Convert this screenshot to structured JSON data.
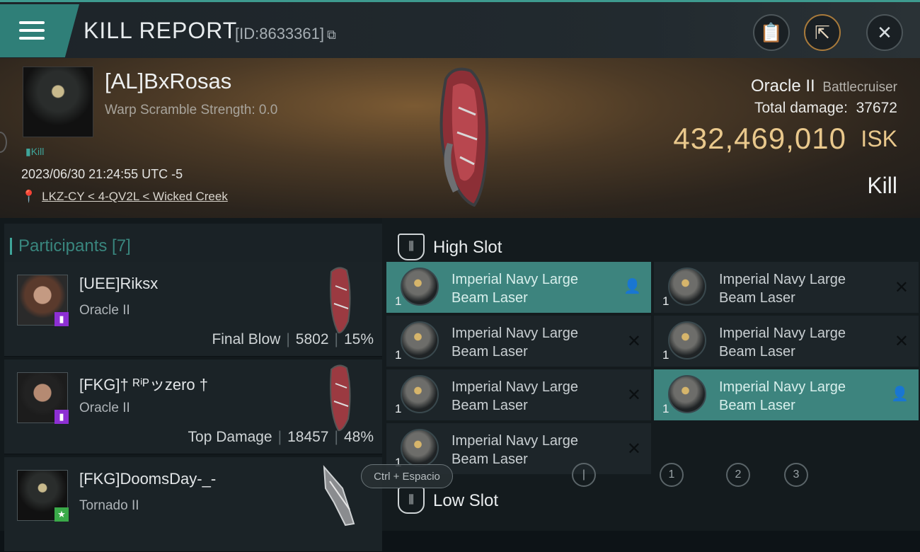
{
  "header": {
    "title": "KILL REPORT",
    "report_id": "[ID:8633361]",
    "copy_icon": "copy-icon",
    "buttons": [
      "clipboard-icon",
      "share-icon",
      "close-icon"
    ]
  },
  "victim": {
    "name": "[AL]BxRosas",
    "warp_scramble": "Warp Scramble Strength: 0.0",
    "kill_tag": "Kill",
    "datetime": "2023/06/30 21:24:55 UTC -5",
    "location": "LKZ-CY < 4-QV2L < Wicked Creek",
    "ship_name": "Oracle II",
    "ship_class": "Battlecruiser",
    "total_damage_label": "Total damage:",
    "total_damage_value": "37672",
    "isk_value": "432,469,010",
    "isk_unit": "ISK",
    "status": "Kill"
  },
  "participants": {
    "title": "Participants [7]",
    "rows": [
      {
        "name": "[UEE]Riksx",
        "ship": "Oracle II",
        "role": "Final Blow",
        "damage": "5802",
        "percent": "15%",
        "badge": "purple"
      },
      {
        "name": "[FKG]† ᴿⁱᴾッzero †",
        "ship": "Oracle II",
        "role": "Top Damage",
        "damage": "18457",
        "percent": "48%",
        "badge": "purple"
      },
      {
        "name": "[FKG]DoomsDay-_-",
        "ship": "Tornado II",
        "role": "",
        "damage": "",
        "percent": "",
        "badge": "green"
      }
    ]
  },
  "fitting": {
    "high_slot_title": "High Slot",
    "low_slot_title": "Low Slot",
    "modules": [
      {
        "line1": "Imperial Navy Large",
        "line2": "Beam Laser",
        "qty": "1",
        "status": "active"
      },
      {
        "line1": "Imperial Navy Large",
        "line2": "Beam Laser",
        "qty": "1",
        "status": "destroyed"
      },
      {
        "line1": "Imperial Navy Large",
        "line2": "Beam Laser",
        "qty": "1",
        "status": "destroyed"
      },
      {
        "line1": "Imperial Navy Large",
        "line2": "Beam Laser",
        "qty": "1",
        "status": "destroyed"
      },
      {
        "line1": "Imperial Navy Large",
        "line2": "Beam Laser",
        "qty": "1",
        "status": "destroyed"
      },
      {
        "line1": "Imperial Navy Large",
        "line2": "Beam Laser",
        "qty": "1",
        "status": "active"
      },
      {
        "line1": "Imperial Navy Large",
        "line2": "Beam Laser",
        "qty": "1",
        "status": "destroyed"
      }
    ],
    "pages": [
      "1",
      "2",
      "3"
    ],
    "shortcut_hint": "Ctrl + Espacio"
  },
  "colors": {
    "accent": "#3d847e",
    "isk": "#e9c88c",
    "badge_purple": "#8d2fd3",
    "badge_green": "#3aaa49"
  }
}
